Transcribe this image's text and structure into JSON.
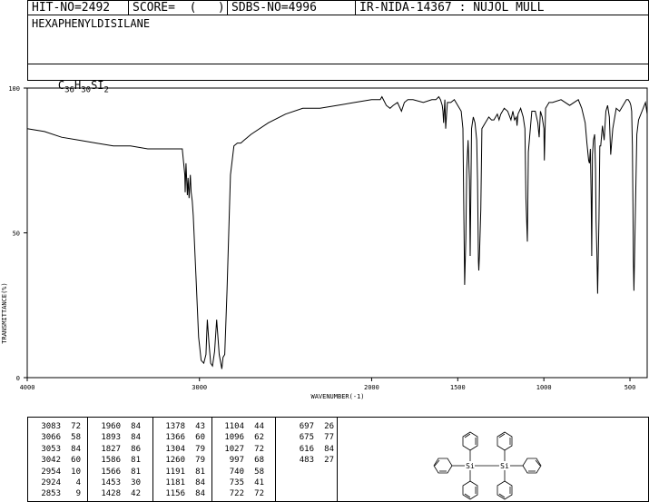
{
  "header": {
    "hit_no": "HIT-NO=2492",
    "score": "SCORE=  (   )",
    "sdbs_no": "SDBS-NO=4996",
    "ir_nida": "IR-NIDA-14367 : NUJOL MULL"
  },
  "compound": {
    "name": "HEXAPHENYLDISILANE",
    "formula_parts": [
      "C",
      "36",
      "H",
      "30",
      "SI",
      "2"
    ]
  },
  "chart_data": {
    "type": "line",
    "xlabel": "WAVENUMBER(-1)",
    "ylabel": "TRANSMITTANCE(%)",
    "xlim": [
      4000,
      400
    ],
    "ylim": [
      0,
      100
    ],
    "x_ticks": [
      4000,
      3000,
      2000,
      1500,
      1000,
      500
    ],
    "y_ticks": [
      0,
      50,
      100
    ],
    "x": [
      4000,
      3900,
      3800,
      3700,
      3600,
      3500,
      3400,
      3300,
      3200,
      3150,
      3100,
      3085,
      3083,
      3078,
      3070,
      3066,
      3060,
      3053,
      3048,
      3042,
      3036,
      3020,
      3005,
      2990,
      2975,
      2962,
      2954,
      2945,
      2935,
      2924,
      2912,
      2900,
      2885,
      2870,
      2863,
      2853,
      2840,
      2820,
      2800,
      2780,
      2760,
      2740,
      2700,
      2600,
      2500,
      2400,
      2300,
      2200,
      2100,
      2000,
      1960,
      1950,
      1940,
      1915,
      1893,
      1875,
      1850,
      1827,
      1810,
      1790,
      1760,
      1700,
      1650,
      1627,
      1610,
      1600,
      1590,
      1586,
      1582,
      1575,
      1570,
      1566,
      1560,
      1540,
      1520,
      1500,
      1480,
      1470,
      1465,
      1460,
      1453,
      1448,
      1440,
      1432,
      1428,
      1420,
      1410,
      1400,
      1390,
      1385,
      1380,
      1378,
      1374,
      1366,
      1360,
      1340,
      1320,
      1304,
      1290,
      1270,
      1260,
      1250,
      1230,
      1210,
      1191,
      1180,
      1170,
      1160,
      1156,
      1150,
      1135,
      1120,
      1110,
      1104,
      1096,
      1090,
      1070,
      1050,
      1035,
      1027,
      1020,
      1010,
      1000,
      997,
      990,
      970,
      950,
      900,
      850,
      800,
      780,
      760,
      750,
      740,
      735,
      730,
      725,
      722,
      718,
      712,
      705,
      700,
      697,
      692,
      688,
      680,
      675,
      670,
      660,
      650,
      640,
      630,
      620,
      616,
      612,
      600,
      580,
      560,
      540,
      520,
      510,
      500,
      495,
      490,
      486,
      483,
      480,
      477,
      470,
      460,
      450,
      430,
      410,
      400
    ],
    "y": [
      86,
      85,
      83,
      82,
      81,
      80,
      80,
      79,
      79,
      79,
      79,
      70,
      64,
      74,
      63,
      69,
      62,
      70,
      64,
      61,
      56,
      35,
      14,
      6,
      5,
      8,
      20,
      12,
      5,
      4,
      9,
      20,
      8,
      3,
      7,
      8,
      30,
      70,
      80,
      81,
      81,
      82,
      84,
      88,
      91,
      93,
      93,
      94,
      95,
      96,
      96,
      96,
      97,
      94,
      93,
      94,
      95,
      92,
      95,
      96,
      96,
      95,
      96,
      96,
      97,
      96,
      94,
      92,
      88,
      96,
      86,
      90,
      95,
      95,
      96,
      94,
      92,
      86,
      60,
      32,
      48,
      72,
      82,
      68,
      42,
      86,
      90,
      88,
      82,
      68,
      40,
      37,
      42,
      58,
      86,
      88,
      90,
      89,
      89,
      91,
      89,
      91,
      93,
      92,
      89,
      92,
      89,
      90,
      87,
      91,
      93,
      90,
      86,
      62,
      47,
      78,
      92,
      92,
      88,
      83,
      92,
      90,
      86,
      75,
      93,
      95,
      95,
      96,
      94,
      96,
      93,
      88,
      81,
      75,
      74,
      79,
      62,
      42,
      77,
      82,
      84,
      72,
      54,
      43,
      29,
      55,
      80,
      80,
      87,
      82,
      92,
      94,
      90,
      84,
      77,
      86,
      93,
      92,
      94,
      96,
      96,
      95,
      94,
      92,
      80,
      60,
      40,
      30,
      52,
      84,
      89,
      92,
      95,
      91,
      84,
      79,
      76
    ]
  },
  "peak_table": [
    [
      [
        "3083",
        "72"
      ],
      [
        "3066",
        "58"
      ],
      [
        "3053",
        "84"
      ],
      [
        "3042",
        "60"
      ],
      [
        "2954",
        "10"
      ],
      [
        "2924",
        "4"
      ],
      [
        "2853",
        "9"
      ]
    ],
    [
      [
        "1960",
        "84"
      ],
      [
        "1893",
        "84"
      ],
      [
        "1827",
        "86"
      ],
      [
        "1586",
        "81"
      ],
      [
        "1566",
        "81"
      ],
      [
        "1453",
        "30"
      ],
      [
        "1428",
        "42"
      ]
    ],
    [
      [
        "1378",
        "43"
      ],
      [
        "1366",
        "60"
      ],
      [
        "1304",
        "79"
      ],
      [
        "1260",
        "79"
      ],
      [
        "1191",
        "81"
      ],
      [
        "1181",
        "84"
      ],
      [
        "1156",
        "84"
      ]
    ],
    [
      [
        "1104",
        "44"
      ],
      [
        "1096",
        "62"
      ],
      [
        "1027",
        "72"
      ],
      [
        "997",
        "68"
      ],
      [
        "740",
        "58"
      ],
      [
        "735",
        "41"
      ],
      [
        "722",
        "72"
      ]
    ],
    [
      [
        "697",
        "26"
      ],
      [
        "675",
        "77"
      ],
      [
        "616",
        "84"
      ],
      [
        "483",
        "27"
      ]
    ]
  ],
  "structure": {
    "atom_label": "Si"
  }
}
